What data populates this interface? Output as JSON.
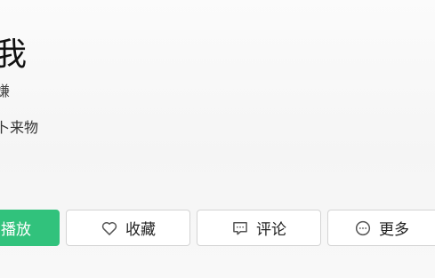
{
  "header": {
    "title": "我",
    "subtitle": "嫌",
    "description": "卜来物"
  },
  "actions": {
    "play_label": "播放",
    "favorite_label": "收藏",
    "comment_label": "评论",
    "more_label": "更多"
  },
  "colors": {
    "accent": "#31c27c",
    "border": "#d4d4d4",
    "background": "#f7f7f7"
  },
  "icons": {
    "favorite": "heart-icon",
    "comment": "comment-icon",
    "more": "more-icon"
  }
}
